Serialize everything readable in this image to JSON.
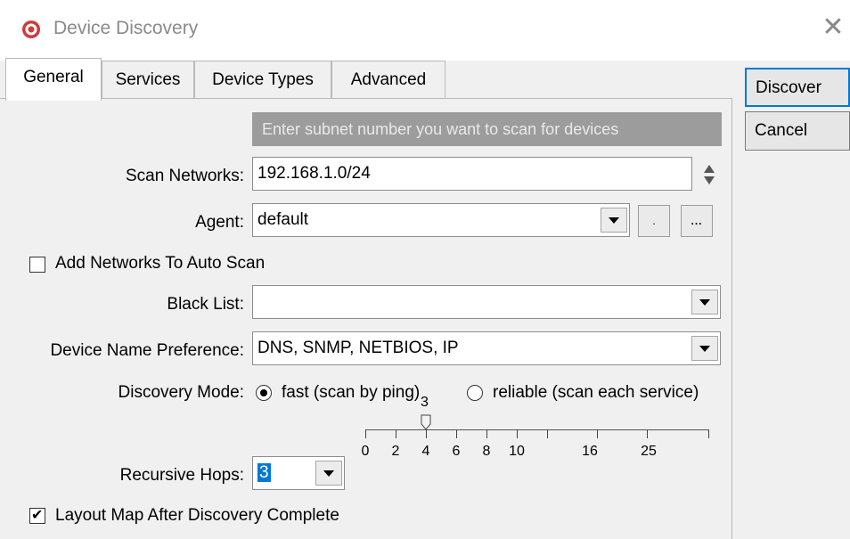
{
  "window": {
    "title": "Device Discovery",
    "app_icon": "target-icon",
    "close_label": "✕"
  },
  "tabs": [
    {
      "label": "General",
      "active": true
    },
    {
      "label": "Services"
    },
    {
      "label": "Device Types"
    },
    {
      "label": "Advanced"
    }
  ],
  "buttons": {
    "discover": "Discover",
    "cancel": "Cancel"
  },
  "general": {
    "hint": "Enter subnet number you want to scan for devices",
    "scan_networks": {
      "label": "Scan Networks:",
      "value": "192.168.1.0/24"
    },
    "agent": {
      "label": "Agent:",
      "value": "default",
      "btn2_label": "...",
      "btn1_label": "."
    },
    "add_networks": {
      "label": "Add Networks To Auto Scan",
      "checked": false
    },
    "black_list": {
      "label": "Black List:",
      "value": ""
    },
    "device_name_pref": {
      "label": "Device Name Preference:",
      "value": "DNS, SNMP, NETBIOS, IP"
    },
    "discovery_mode": {
      "label": "Discovery Mode:",
      "fast": "fast (scan by ping)",
      "reliable": "reliable (scan each service)",
      "selected": "fast"
    },
    "recursive_hops": {
      "label": "Recursive Hops:",
      "value": "3",
      "slider_value": "3",
      "ticks": [
        "0",
        "2",
        "4",
        "6",
        "8",
        "10",
        "16",
        "25"
      ]
    },
    "layout_map": {
      "label": "Layout Map After Discovery Complete",
      "checked": true
    }
  }
}
